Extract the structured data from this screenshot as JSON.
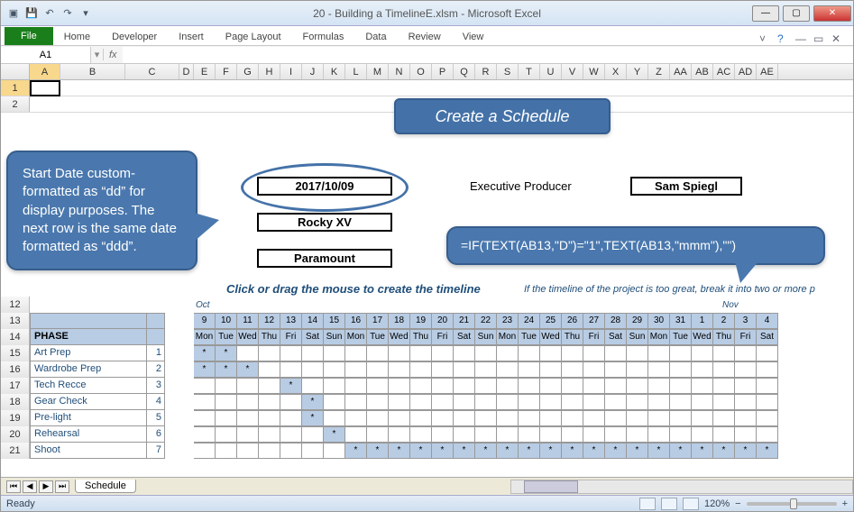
{
  "app": {
    "title": "20 - Building a TimelineE.xlsm  -  Microsoft Excel",
    "name_box": "A1",
    "formula": "",
    "status": "Ready",
    "zoom": "120%",
    "sheet": "Schedule"
  },
  "ribbon": {
    "file": "File",
    "tabs": [
      "Home",
      "Developer",
      "Insert",
      "Page Layout",
      "Formulas",
      "Data",
      "Review",
      "View"
    ]
  },
  "columns": [
    "A",
    "B",
    "C",
    "D",
    "E",
    "F",
    "G",
    "H",
    "I",
    "J",
    "K",
    "L",
    "M",
    "N",
    "O",
    "P",
    "Q",
    "R",
    "S",
    "T",
    "U",
    "V",
    "W",
    "X",
    "Y",
    "Z",
    "AA",
    "AB",
    "AC",
    "AD",
    "AE"
  ],
  "row_numbers": [
    1,
    2,
    "",
    "",
    "",
    "",
    "",
    "",
    "",
    "",
    "",
    12,
    13,
    14,
    15,
    16,
    17,
    18,
    19,
    20,
    21
  ],
  "banner": "Create a Schedule",
  "form": {
    "date": "2017/10/09",
    "title": "Rocky XV",
    "studio": "Paramount",
    "exec_label": "Executive Producer",
    "exec_value": "Sam Spiegl"
  },
  "instructions": {
    "main": "Click or drag the mouse to create the timeline",
    "note": "If the timeline of the project is too great, break it into two or more p"
  },
  "months": {
    "oct": "Oct",
    "nov": "Nov"
  },
  "timeline": {
    "days": [
      "9",
      "10",
      "11",
      "12",
      "13",
      "14",
      "15",
      "16",
      "17",
      "18",
      "19",
      "20",
      "21",
      "22",
      "23",
      "24",
      "25",
      "26",
      "27",
      "28",
      "29",
      "30",
      "31",
      "1",
      "2",
      "3",
      "4"
    ],
    "dow": [
      "Mon",
      "Tue",
      "Wed",
      "Thu",
      "Fri",
      "Sat",
      "Sun",
      "Mon",
      "Tue",
      "Wed",
      "Thu",
      "Fri",
      "Sat",
      "Sun",
      "Mon",
      "Tue",
      "Wed",
      "Thu",
      "Fri",
      "Sat",
      "Sun",
      "Mon",
      "Tue",
      "Wed",
      "Thu",
      "Fri",
      "Sat"
    ],
    "phase_header": "PHASE",
    "phases": [
      {
        "n": 1,
        "name": "Art Prep",
        "marks": [
          0,
          1
        ]
      },
      {
        "n": 2,
        "name": "Wardrobe Prep",
        "marks": [
          0,
          1,
          2
        ]
      },
      {
        "n": 3,
        "name": "Tech Recce",
        "marks": [
          4
        ]
      },
      {
        "n": 4,
        "name": "Gear Check",
        "marks": [
          5
        ]
      },
      {
        "n": 5,
        "name": "Pre-light",
        "marks": [
          5
        ]
      },
      {
        "n": 6,
        "name": "Rehearsal",
        "marks": [
          6
        ]
      },
      {
        "n": 7,
        "name": "Shoot",
        "marks": [
          7,
          8,
          9,
          10,
          11,
          12,
          13,
          14,
          15,
          16,
          17,
          18,
          19,
          20,
          21,
          22,
          23,
          24,
          25,
          26
        ]
      }
    ]
  },
  "callouts": {
    "c1": "Start Date custom-formatted as “dd” for display purposes. The next row is the same date formatted as “ddd”.",
    "c2": "=IF(TEXT(AB13,\"D\")=\"1\",TEXT(AB13,\"mmm\"),\"\")"
  }
}
